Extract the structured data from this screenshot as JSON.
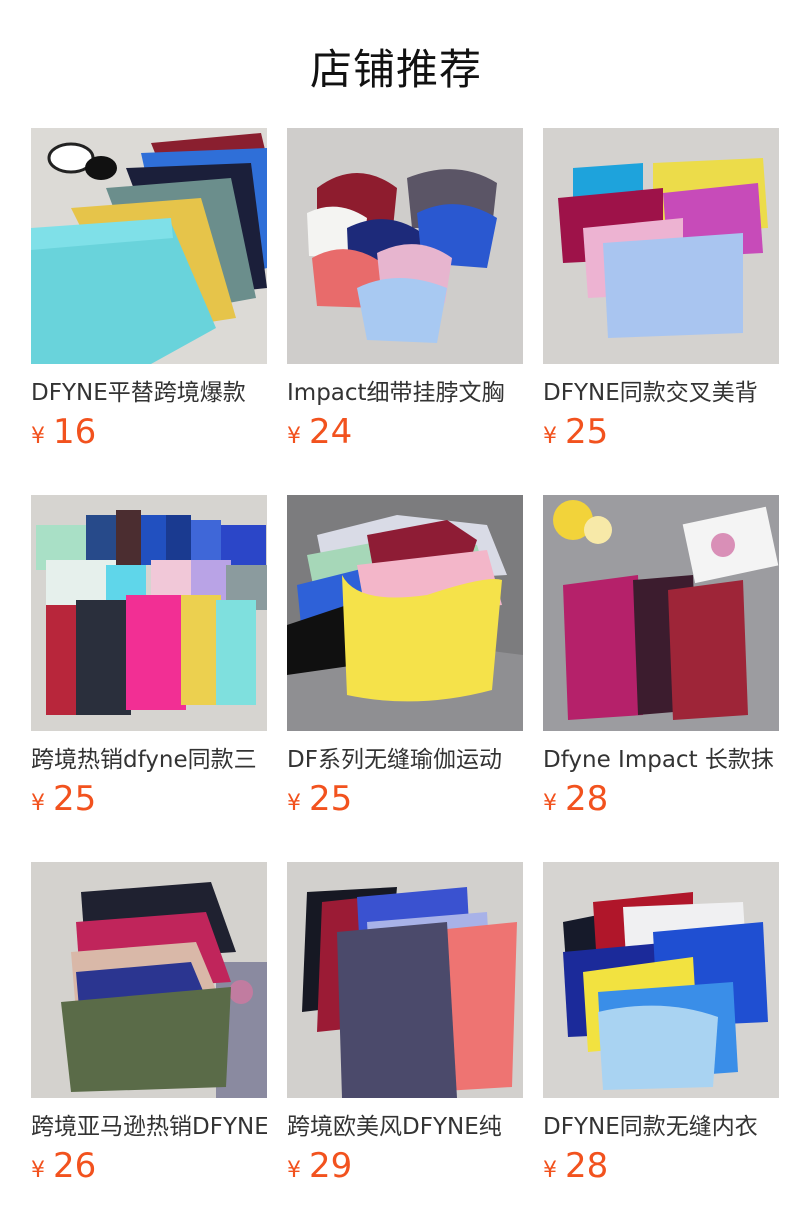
{
  "page": {
    "title": "店铺推荐"
  },
  "products": [
    {
      "name": "DFYNE平替跨境爆款",
      "currency": "¥",
      "price": "16",
      "image": "leggings-shorts-stack"
    },
    {
      "name": "Impact细带挂脖文胸",
      "currency": "¥",
      "price": "24",
      "image": "halter-bras-pile"
    },
    {
      "name": "DFYNE同款交叉美背",
      "currency": "¥",
      "price": "25",
      "image": "cross-back-bras"
    },
    {
      "name": "跨境热销dfyne同款三",
      "currency": "¥",
      "price": "25",
      "image": "shorts-color-grid"
    },
    {
      "name": "DF系列无缝瑜伽运动",
      "currency": "¥",
      "price": "25",
      "image": "yellow-bra-stack"
    },
    {
      "name": "Dfyne Impact 长款抹",
      "currency": "¥",
      "price": "28",
      "image": "halter-tanks"
    },
    {
      "name": "跨境亚马逊热销DFYNE",
      "currency": "¥",
      "price": "26",
      "image": "strappy-bras-olive"
    },
    {
      "name": "跨境欧美风DFYNE纯",
      "currency": "¥",
      "price": "29",
      "image": "purple-coral-tanks"
    },
    {
      "name": "DFYNE同款无缝内衣",
      "currency": "¥",
      "price": "28",
      "image": "blue-bra-stack"
    }
  ]
}
